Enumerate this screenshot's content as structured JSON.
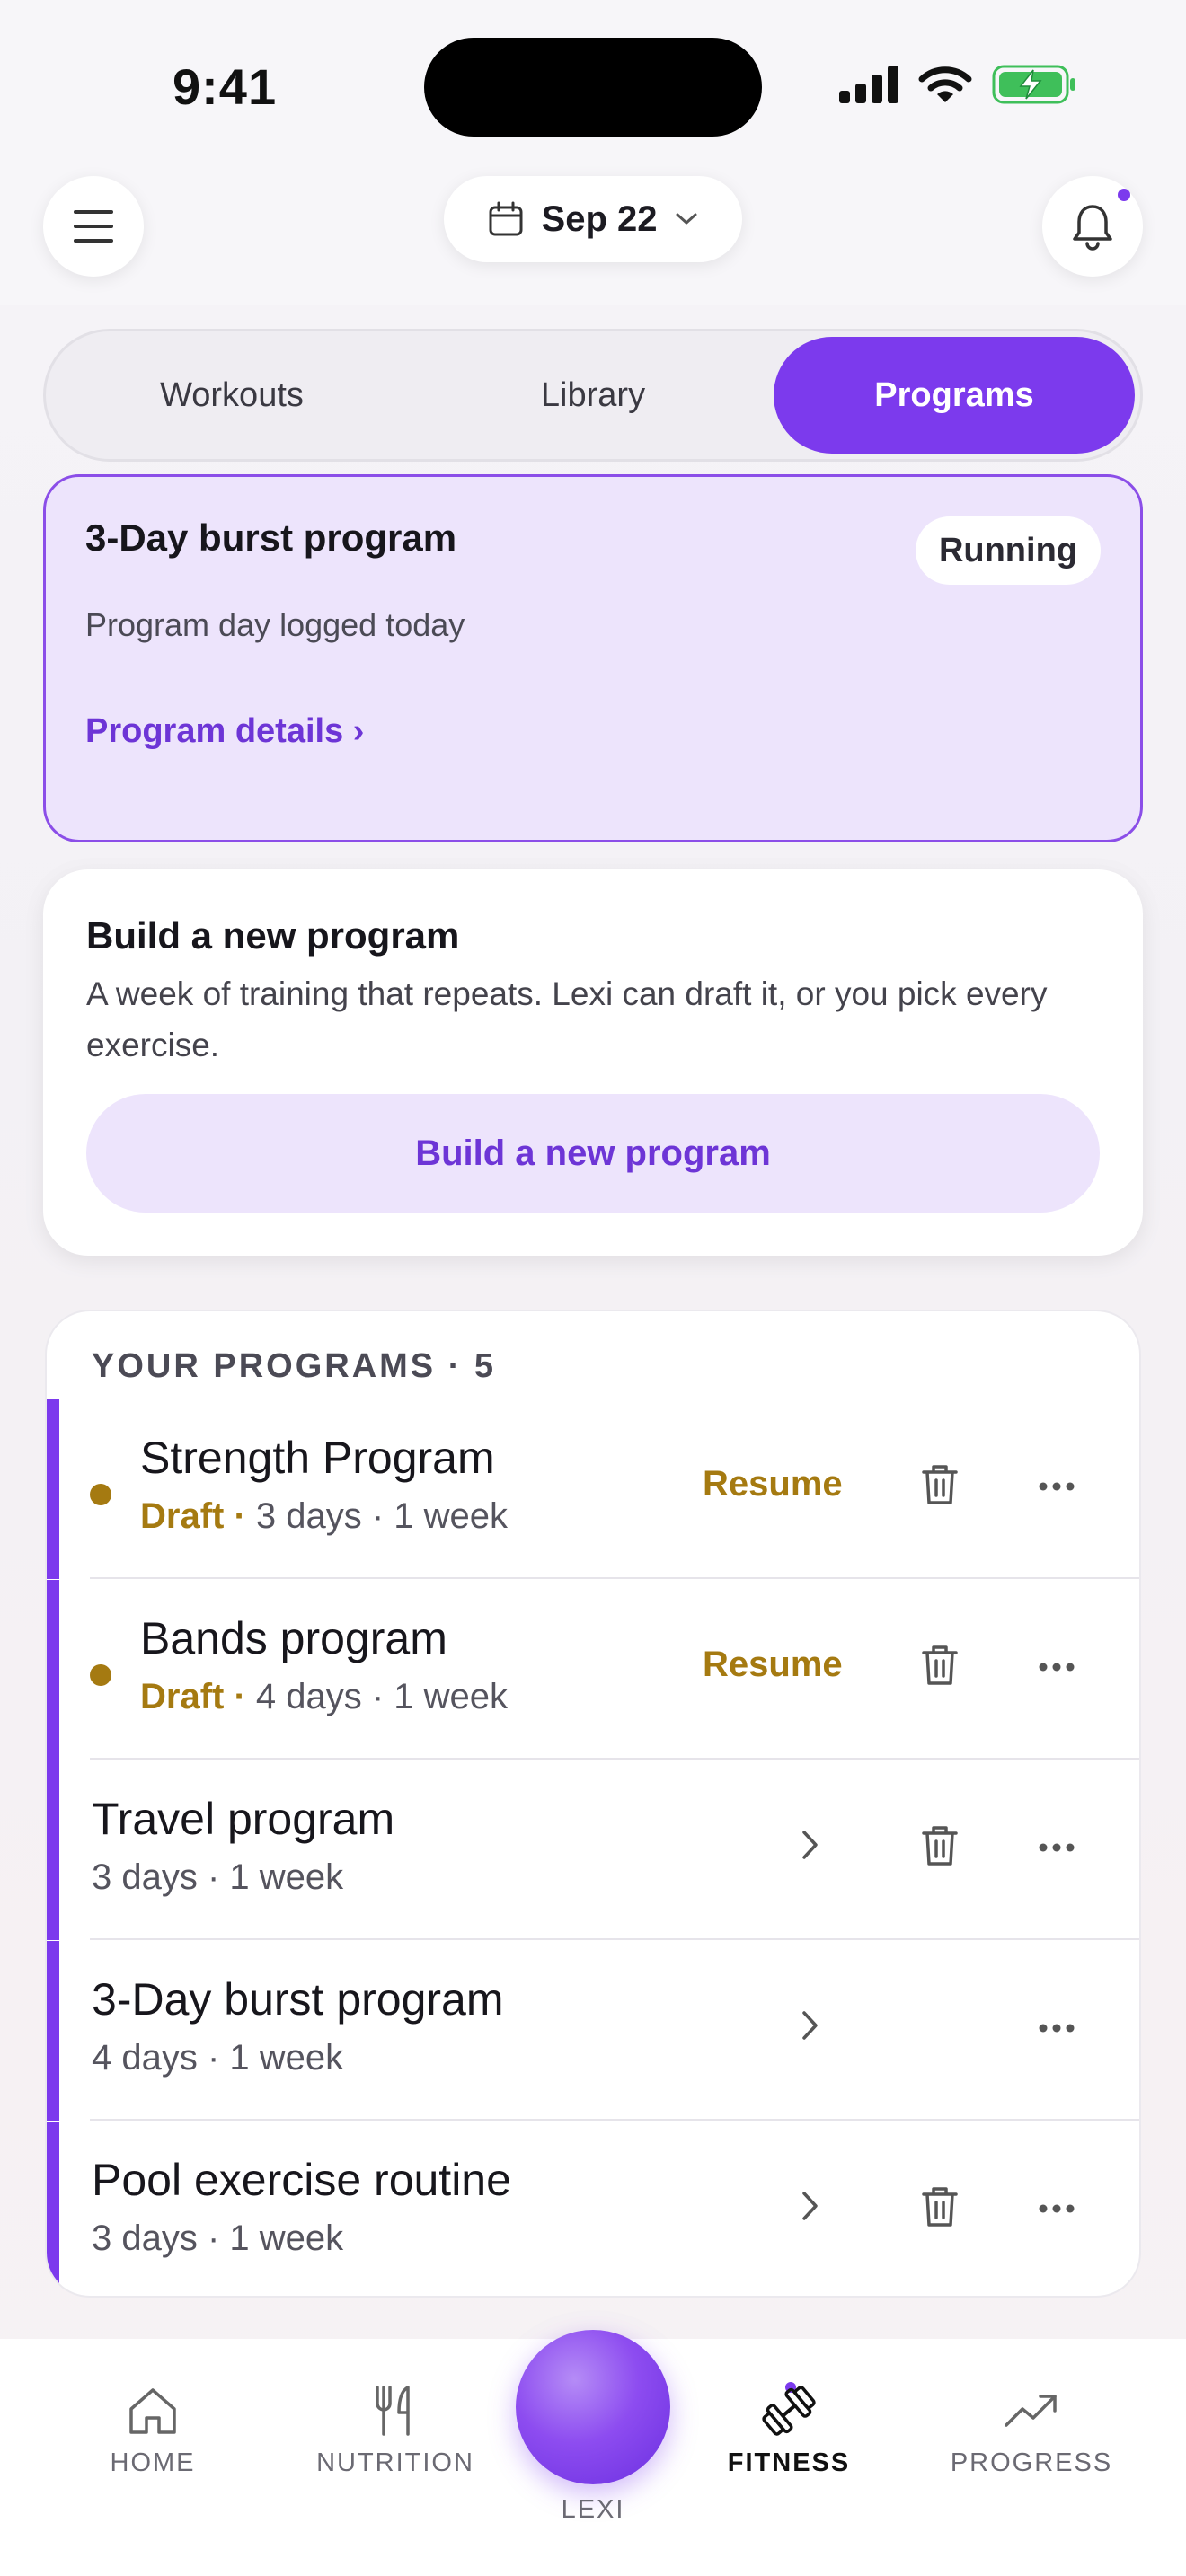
{
  "status_bar": {
    "time": "9:41"
  },
  "header": {
    "date_label": "Sep 22"
  },
  "tabs": [
    {
      "label": "Workouts",
      "active": false
    },
    {
      "label": "Library",
      "active": false
    },
    {
      "label": "Programs",
      "active": true
    }
  ],
  "running_program": {
    "title": "3-Day burst program",
    "badge": "Running",
    "subtitle": "Program day logged today",
    "link": "Program details ›"
  },
  "build_card": {
    "title": "Build a new program",
    "description": "A week of training that repeats. Lexi can draft it, or you pick every exercise.",
    "button_label": "Build a new program"
  },
  "programs": {
    "heading": "YOUR PROGRAMS · 5",
    "items": [
      {
        "name": "Strength Program",
        "status": "Draft",
        "separator": " · ",
        "meta": "3 days · 1 week",
        "action": "Resume",
        "deletable": true
      },
      {
        "name": "Bands program",
        "status": "Draft",
        "separator": " · ",
        "meta": "4 days · 1 week",
        "action": "Resume",
        "deletable": true
      },
      {
        "name": "Travel program",
        "status": "",
        "separator": "",
        "meta": "3 days · 1 week",
        "action": "",
        "deletable": true
      },
      {
        "name": "3-Day burst program",
        "status": "",
        "separator": "",
        "meta": "4 days · 1 week",
        "action": "",
        "deletable": false
      },
      {
        "name": "Pool exercise routine",
        "status": "",
        "separator": "",
        "meta": "3 days · 1 week",
        "action": "",
        "deletable": true
      }
    ]
  },
  "bottom_nav": {
    "home": "HOME",
    "nutrition": "NUTRITION",
    "lexi": "LEXI",
    "fitness": "FITNESS",
    "progress": "PROGRESS"
  },
  "colors": {
    "accent": "#7c3aed",
    "draft": "#a57a11",
    "running_card_bg": "#ede4fc"
  }
}
